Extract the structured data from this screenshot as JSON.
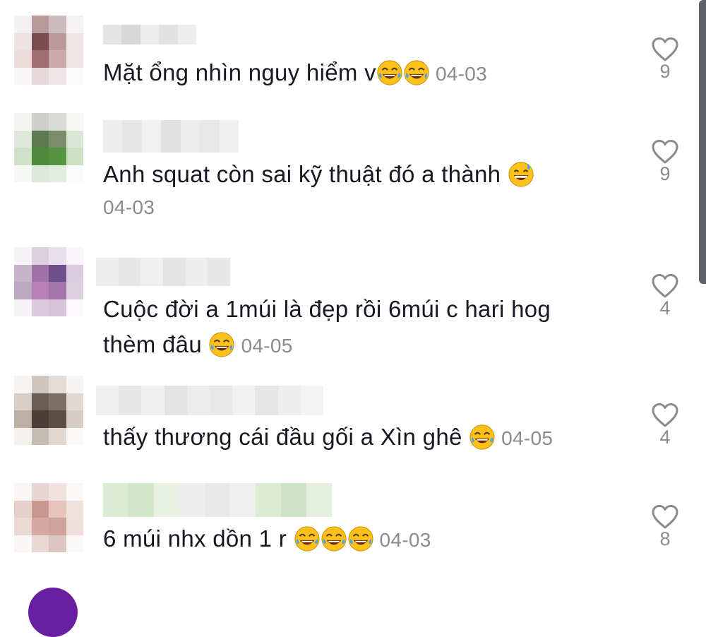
{
  "comments": [
    {
      "text": "Mặt ổng nhìn nguy hiểm v",
      "emoji_count": 2,
      "emoji": "tears-of-joy",
      "date": "04-03",
      "likes": "9"
    },
    {
      "text": "Anh squat còn sai kỹ thuật đó a thành ",
      "emoji_count": 1,
      "emoji": "grinning-sweat",
      "date": "04-03",
      "likes": "9"
    },
    {
      "text": "Cuộc đời a 1múi là đẹp rồi 6múi c hari hog thèm đâu ",
      "emoji_count": 1,
      "emoji": "tears-of-joy",
      "date": "04-05",
      "likes": "4"
    },
    {
      "text": "thấy thương cái đầu gối a Xìn ghê ",
      "emoji_count": 1,
      "emoji": "tears-of-joy",
      "date": "04-05",
      "likes": "4"
    },
    {
      "text": "6 múi nhx dồn 1 r ",
      "emoji_count": 3,
      "emoji": "tears-of-joy",
      "date": "04-03",
      "likes": "8"
    }
  ],
  "colors": {
    "text": "#161823",
    "secondary": "#8a8b91",
    "partial_avatar": "#6a1fa3"
  },
  "icons": {
    "like": "heart-outline-icon"
  }
}
